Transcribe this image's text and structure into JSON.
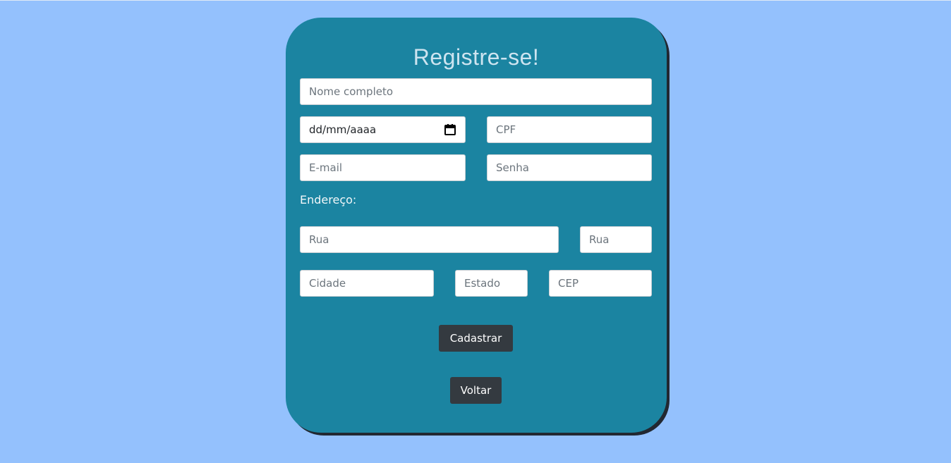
{
  "page": {
    "title": "Registre-se!"
  },
  "form": {
    "fields": {
      "full_name_placeholder": "Nome completo",
      "birth_date_value": "dd/mm/aaaa",
      "cpf_placeholder": "CPF",
      "email_placeholder": "E-mail",
      "password_placeholder": "Senha",
      "street_placeholder": "Rua",
      "number_placeholder": "Rua",
      "city_placeholder": "Cidade",
      "state_placeholder": "Estado",
      "zip_placeholder": "CEP"
    },
    "address_label": "Endereço:",
    "buttons": {
      "submit_label": "Cadastrar",
      "back_label": "Voltar"
    }
  },
  "icons": {
    "date_picker": "calendar-icon"
  },
  "colors": {
    "background": "#94c1fd",
    "card": "#1b84a1",
    "card_shadow": "#222831",
    "button": "#343a40"
  }
}
